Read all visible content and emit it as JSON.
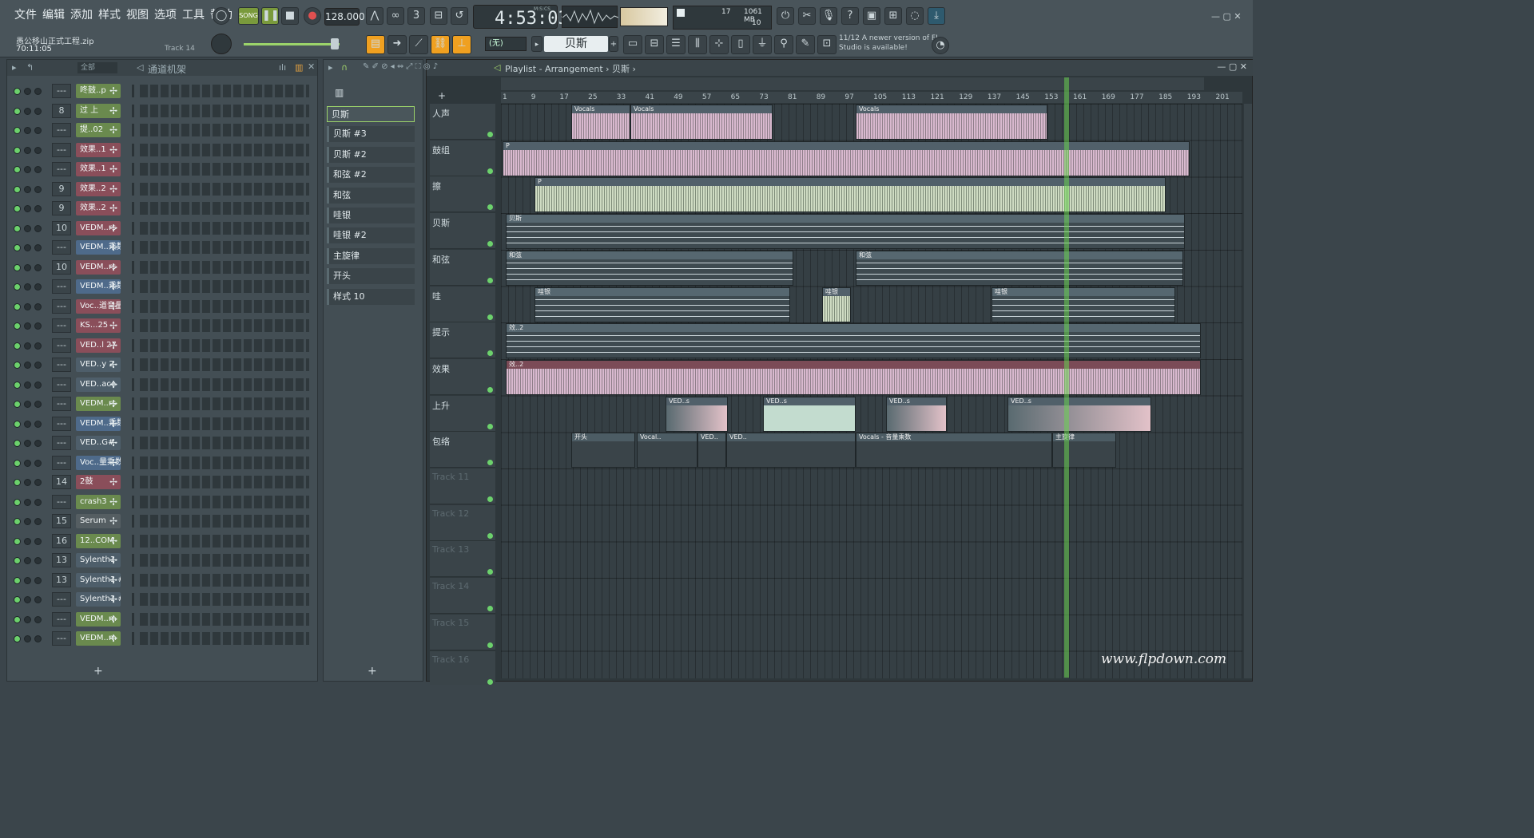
{
  "menu": [
    "文件",
    "编辑",
    "添加",
    "样式",
    "视图",
    "选项",
    "工具",
    "帮助"
  ],
  "transport": {
    "mode": "SONG",
    "tempo": "128.000",
    "time_label": "M:S:CS",
    "time": "4:53:03",
    "cpu": "17",
    "ram": "1061 MB",
    "poly": "10"
  },
  "project": {
    "name": "愚公移山正式工程.zip",
    "time": "70:11:05",
    "track": "Track 14"
  },
  "toolbar": {
    "snap": "(无)",
    "pattern": "贝斯"
  },
  "news": {
    "date": "11/12",
    "text": "A newer version of FL Studio is available!"
  },
  "rack": {
    "filter": "全部",
    "title": "通道机架",
    "add": "+"
  },
  "channels": [
    {
      "num": "---",
      "name": "咚鼓..p",
      "color": "#6a8a4e"
    },
    {
      "num": "8",
      "name": "过 上",
      "color": "#6a8a4e"
    },
    {
      "num": "---",
      "name": "提..02",
      "color": "#6a8a4e"
    },
    {
      "num": "---",
      "name": "效果..1",
      "color": "#8a4e5a"
    },
    {
      "num": "---",
      "name": "效果..1",
      "color": "#8a4e5a"
    },
    {
      "num": "9",
      "name": "效果..2",
      "color": "#8a4e5a"
    },
    {
      "num": "9",
      "name": "效果..2",
      "color": "#8a4e5a"
    },
    {
      "num": "10",
      "name": "VEDM..rs",
      "color": "#8a4e5a"
    },
    {
      "num": "---",
      "name": "VEDM..乘数",
      "color": "#4e6a8a"
    },
    {
      "num": "10",
      "name": "VEDM..rs",
      "color": "#8a4e5a"
    },
    {
      "num": "---",
      "name": "VEDM..乘数",
      "color": "#4e6a8a"
    },
    {
      "num": "---",
      "name": "Voc..道音量",
      "color": "#8a4e5a"
    },
    {
      "num": "---",
      "name": "KS...25",
      "color": "#8a4e5a"
    },
    {
      "num": "---",
      "name": "VED..l 27",
      "color": "#8a4e5a"
    },
    {
      "num": "---",
      "name": "VED..y 2",
      "color": "#4e5e6a"
    },
    {
      "num": "---",
      "name": "VED..ace",
      "color": "#4e5e6a"
    },
    {
      "num": "---",
      "name": "VEDM..rs",
      "color": "#6a8a4e"
    },
    {
      "num": "---",
      "name": "VEDM..乘数",
      "color": "#4e6a8a"
    },
    {
      "num": "---",
      "name": "VED..G#",
      "color": "#4e5e6a"
    },
    {
      "num": "---",
      "name": "Voc..量乘数",
      "color": "#4e6a8a"
    },
    {
      "num": "14",
      "name": "2鼓",
      "color": "#8a4e5a"
    },
    {
      "num": "---",
      "name": "crash3",
      "color": "#6a8a4e"
    },
    {
      "num": "15",
      "name": "Serum",
      "color": "#555e62"
    },
    {
      "num": "16",
      "name": "12..COM",
      "color": "#6a8a4e"
    },
    {
      "num": "13",
      "name": "Sylenth1",
      "color": "#4e5e6a"
    },
    {
      "num": "13",
      "name": "Sylenth1 #2",
      "color": "#4e5e6a"
    },
    {
      "num": "---",
      "name": "Sylenth1 #3",
      "color": "#4e5e6a"
    },
    {
      "num": "---",
      "name": "VEDM..m",
      "color": "#6a8a4e"
    },
    {
      "num": "---",
      "name": "VEDM..m",
      "color": "#6a8a4e"
    }
  ],
  "patterns": [
    "贝斯",
    "贝斯 #3",
    "贝斯 #2",
    "和弦 #2",
    "和弦",
    "哇银",
    "哇银 #2",
    "主旋律",
    "开头",
    "样式 10"
  ],
  "playlist": {
    "title": "Playlist - Arrangement › 贝斯 ›",
    "ruler": [
      "1",
      "9",
      "17",
      "25",
      "33",
      "41",
      "49",
      "57",
      "65",
      "73",
      "81",
      "89",
      "97",
      "105",
      "113",
      "121",
      "129",
      "137",
      "145",
      "153",
      "161",
      "169",
      "177",
      "185",
      "193",
      "201"
    ]
  },
  "tracks": [
    "人声",
    "鼓组",
    "擦",
    "贝斯",
    "和弦",
    "哇",
    "提示",
    "效果",
    "上升",
    "包络",
    "Track 11",
    "Track 12",
    "Track 13",
    "Track 14",
    "Track 15",
    "Track 16"
  ],
  "clips": {
    "vocals": "Vocals",
    "drums": "P",
    "chords": "和弦",
    "bass": "贝斯",
    "wow": "哇银",
    "cue": "效..2",
    "fx": "效..2",
    "riser": "VED..s",
    "env_a": "开头",
    "env_b": "Vocal..",
    "env_c": "VED..",
    "env_d": "Vocals - 音量乘数",
    "env_e": "主旋律"
  },
  "watermark": "www.flpdown.com",
  "picker_add": "+"
}
